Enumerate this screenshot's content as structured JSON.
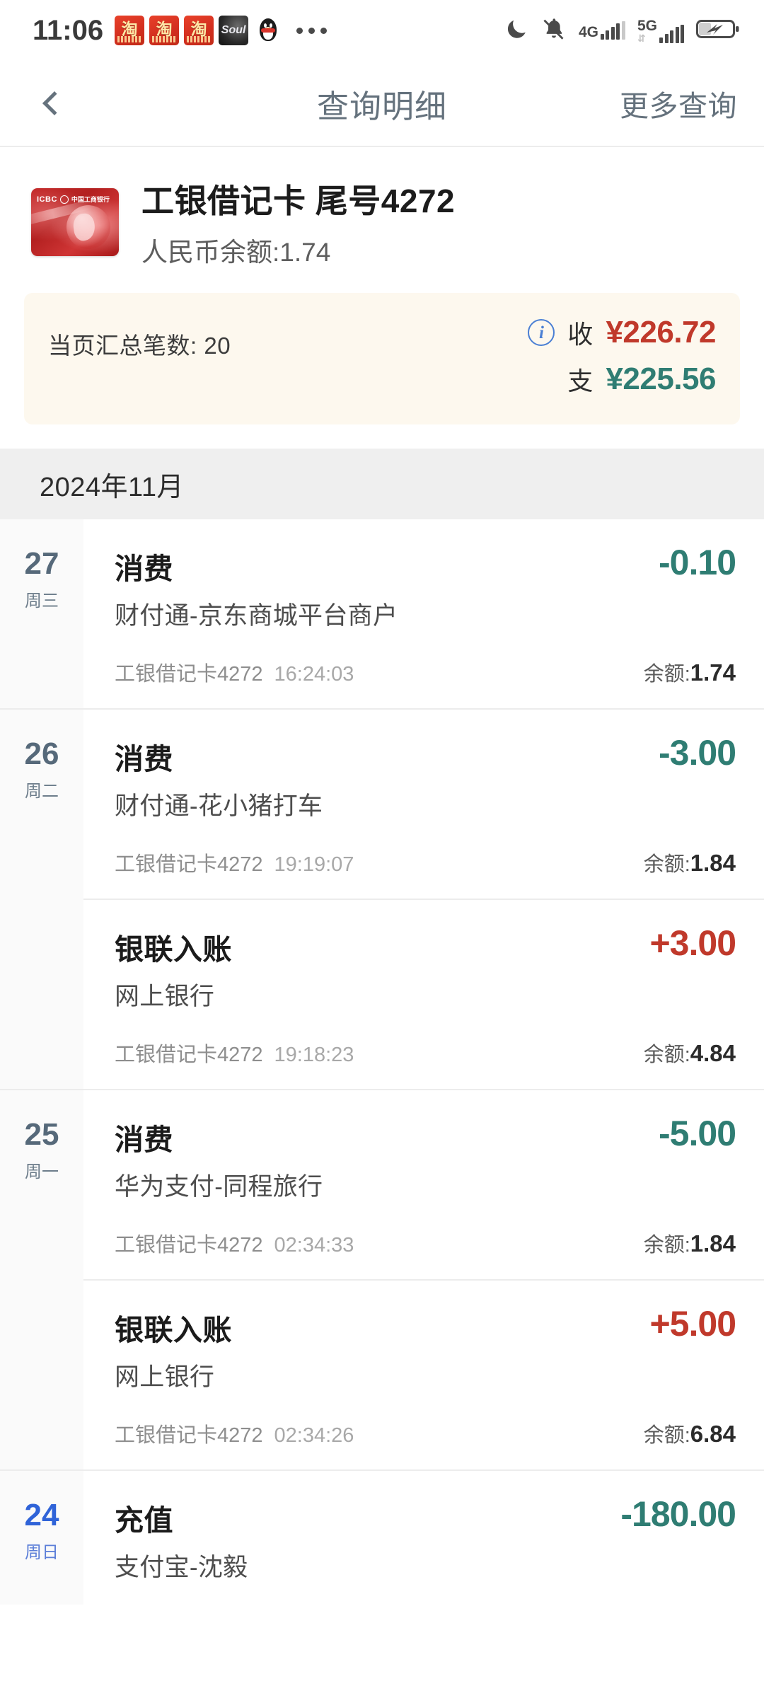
{
  "status_bar": {
    "time": "11:06",
    "app_icons": [
      {
        "name": "taobao-icon",
        "glyph": "淘"
      },
      {
        "name": "taobao-icon",
        "glyph": "淘"
      },
      {
        "name": "taobao-icon",
        "glyph": "淘"
      },
      {
        "name": "soul-icon",
        "glyph": "Soul"
      },
      {
        "name": "qq-icon",
        "glyph": ""
      }
    ],
    "overflow": "•••",
    "right_icons": [
      "moon-icon",
      "bell-muted-icon",
      "signal-4g-icon",
      "signal-5g-icon",
      "battery-charging-icon"
    ],
    "network_4g": "4G",
    "network_5g": "5G"
  },
  "header": {
    "back_icon": "chevron-left-icon",
    "title": "查询明细",
    "action": "更多查询"
  },
  "card": {
    "logo_en": "ICBC",
    "logo_cn": "中国工商银行",
    "name": "工银借记卡  尾号4272",
    "balance_line": "人民币余额:1.74"
  },
  "summary": {
    "count_label": "当页汇总笔数: 20",
    "info_icon": "info-circle-icon",
    "info_glyph": "i",
    "income_label": "收",
    "income_value": "¥226.72",
    "expense_label": "支",
    "expense_value": "¥225.56",
    "income_color": "#c0392b",
    "expense_color": "#2f7d73",
    "background": "#fdf8ee"
  },
  "month_header": "2024年11月",
  "transactions": [
    {
      "day": "27",
      "weekday": "周三",
      "is_sunday": false,
      "rows": [
        {
          "type": "消费",
          "desc": "财付通-京东商城平台商户",
          "card": "工银借记卡4272",
          "time": "16:24:03",
          "amount": "-0.10",
          "sign": "neg",
          "balance_label": "余额:",
          "balance_value": "1.74"
        }
      ]
    },
    {
      "day": "26",
      "weekday": "周二",
      "is_sunday": false,
      "rows": [
        {
          "type": "消费",
          "desc": "财付通-花小猪打车",
          "card": "工银借记卡4272",
          "time": "19:19:07",
          "amount": "-3.00",
          "sign": "neg",
          "balance_label": "余额:",
          "balance_value": "1.84"
        },
        {
          "type": "银联入账",
          "desc": "网上银行",
          "card": "工银借记卡4272",
          "time": "19:18:23",
          "amount": "+3.00",
          "sign": "pos",
          "balance_label": "余额:",
          "balance_value": "4.84"
        }
      ]
    },
    {
      "day": "25",
      "weekday": "周一",
      "is_sunday": false,
      "rows": [
        {
          "type": "消费",
          "desc": "华为支付-同程旅行",
          "card": "工银借记卡4272",
          "time": "02:34:33",
          "amount": "-5.00",
          "sign": "neg",
          "balance_label": "余额:",
          "balance_value": "1.84"
        },
        {
          "type": "银联入账",
          "desc": "网上银行",
          "card": "工银借记卡4272",
          "time": "02:34:26",
          "amount": "+5.00",
          "sign": "pos",
          "balance_label": "余额:",
          "balance_value": "6.84"
        }
      ]
    },
    {
      "day": "24",
      "weekday": "周日",
      "is_sunday": true,
      "rows": [
        {
          "type": "充值",
          "desc": "支付宝-沈毅",
          "card": "",
          "time": "",
          "amount": "-180.00",
          "sign": "neg",
          "balance_label": "",
          "balance_value": ""
        }
      ]
    }
  ]
}
